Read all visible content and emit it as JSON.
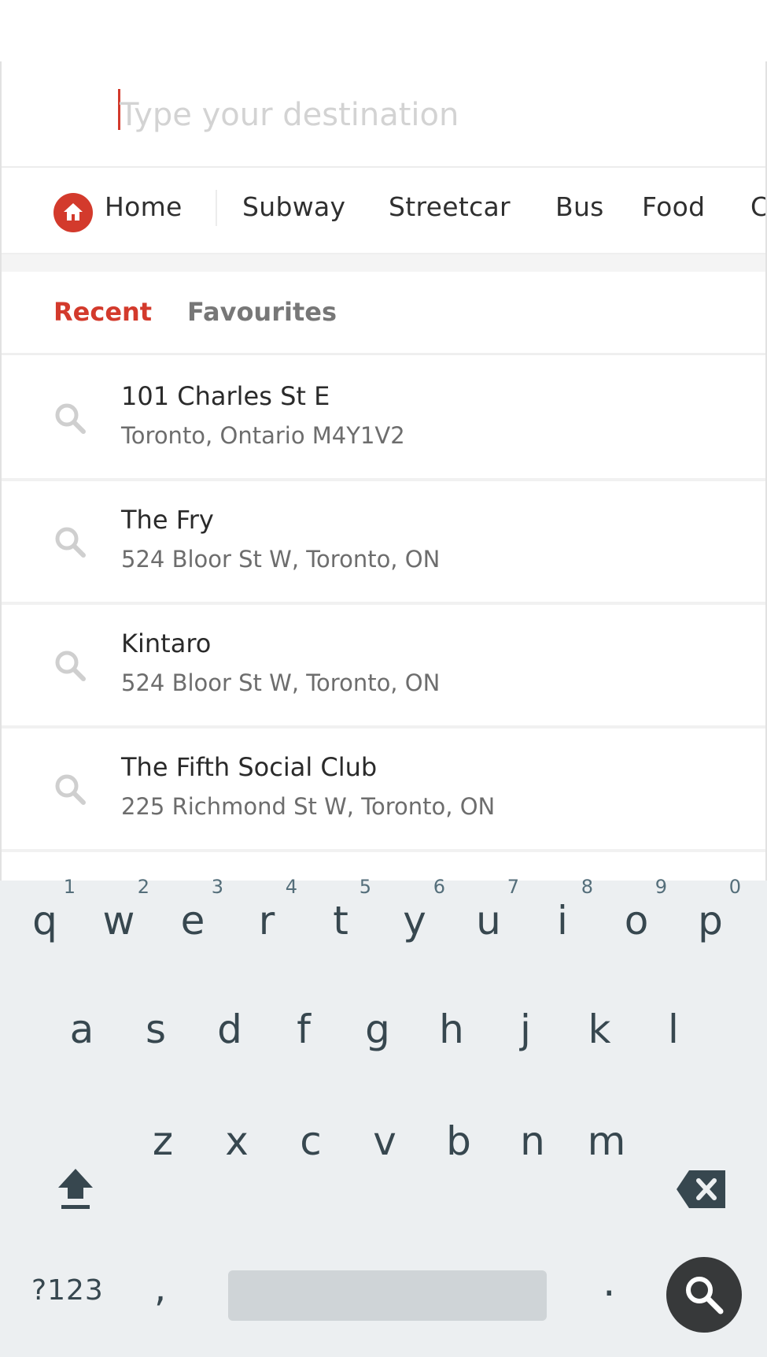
{
  "search": {
    "placeholder": "Type your destination",
    "value": ""
  },
  "categories": {
    "items": [
      "Home",
      "Subway",
      "Streetcar",
      "Bus",
      "Food",
      "C"
    ],
    "home_icon": "home-icon"
  },
  "tabs": {
    "active": "Recent",
    "items": [
      "Recent",
      "Favourites"
    ]
  },
  "recent": [
    {
      "title": "101 Charles St E",
      "subtitle": "Toronto, Ontario M4Y1V2",
      "icon": "search-icon"
    },
    {
      "title": "The Fry",
      "subtitle": "524 Bloor St W, Toronto, ON",
      "icon": "search-icon"
    },
    {
      "title": "Kintaro",
      "subtitle": "524 Bloor St W, Toronto, ON",
      "icon": "search-icon"
    },
    {
      "title": "The Fifth Social Club",
      "subtitle": "225 Richmond St W, Toronto, ON",
      "icon": "search-icon"
    }
  ],
  "keyboard": {
    "row1": [
      "q",
      "w",
      "e",
      "r",
      "t",
      "y",
      "u",
      "i",
      "o",
      "p"
    ],
    "row1_hints": [
      "1",
      "2",
      "3",
      "4",
      "5",
      "6",
      "7",
      "8",
      "9",
      "0"
    ],
    "row2": [
      "a",
      "s",
      "d",
      "f",
      "g",
      "h",
      "j",
      "k",
      "l"
    ],
    "row3": [
      "z",
      "x",
      "c",
      "v",
      "b",
      "n",
      "m"
    ],
    "symbols": "?123",
    "comma": ",",
    "period": ".",
    "shift_icon": "shift-icon",
    "backspace_icon": "backspace-icon",
    "search_icon": "search-icon"
  },
  "colors": {
    "accent": "#d33a2c",
    "keyboard_bg": "#eceff1",
    "key_text": "#37474f"
  }
}
